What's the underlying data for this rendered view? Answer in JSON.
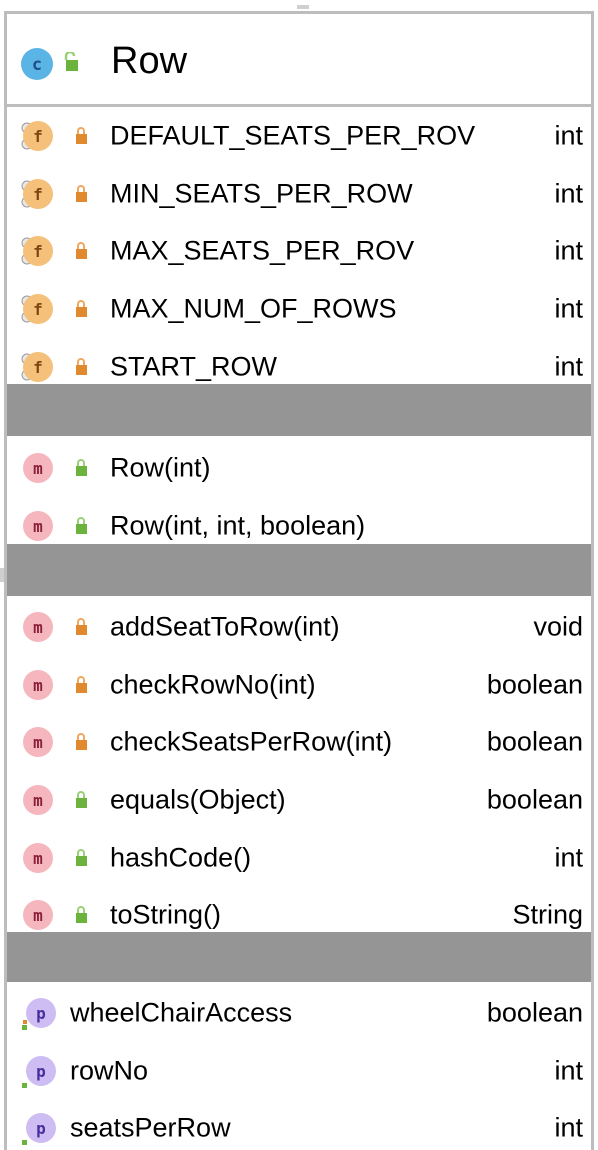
{
  "class": {
    "name": "Row",
    "kind_icon": "class-icon",
    "visibility_icon": "public-icon"
  },
  "fields": [
    {
      "name": "DEFAULT_SEATS_PER_ROV",
      "type": "int",
      "icon": "static-final-field-icon",
      "visibility": "private"
    },
    {
      "name": "MIN_SEATS_PER_ROW",
      "type": "int",
      "icon": "static-final-field-icon",
      "visibility": "private"
    },
    {
      "name": "MAX_SEATS_PER_ROV",
      "type": "int",
      "icon": "static-final-field-icon",
      "visibility": "private"
    },
    {
      "name": "MAX_NUM_OF_ROWS",
      "type": "int",
      "icon": "static-final-field-icon",
      "visibility": "private"
    },
    {
      "name": "START_ROW",
      "type": "int",
      "icon": "static-final-field-icon",
      "visibility": "private"
    }
  ],
  "constructors": [
    {
      "name": "Row(int)",
      "type": "",
      "icon": "method-icon",
      "visibility": "public"
    },
    {
      "name": "Row(int, int, boolean)",
      "type": "",
      "icon": "method-icon",
      "visibility": "public"
    }
  ],
  "methods": [
    {
      "name": "addSeatToRow(int)",
      "type": "void",
      "icon": "method-icon",
      "visibility": "private"
    },
    {
      "name": "checkRowNo(int)",
      "type": "boolean",
      "icon": "method-icon",
      "visibility": "private"
    },
    {
      "name": "checkSeatsPerRow(int)",
      "type": "boolean",
      "icon": "method-icon",
      "visibility": "private"
    },
    {
      "name": "equals(Object)",
      "type": "boolean",
      "icon": "method-icon",
      "visibility": "public"
    },
    {
      "name": "hashCode()",
      "type": "int",
      "icon": "method-icon",
      "visibility": "public"
    },
    {
      "name": "toString()",
      "type": "String",
      "icon": "method-icon",
      "visibility": "public"
    }
  ],
  "properties": [
    {
      "name": "wheelChairAccess",
      "type": "boolean",
      "icon": "property-icon",
      "accessors": "read-write"
    },
    {
      "name": "rowNo",
      "type": "int",
      "icon": "property-icon",
      "accessors": "read"
    },
    {
      "name": "seatsPerRow",
      "type": "int",
      "icon": "property-icon",
      "accessors": "read"
    }
  ],
  "colors": {
    "border": "#bdbdbd",
    "separator": "#959595",
    "class_badge": "#5ab5e6",
    "method_badge": "#f5b7bd",
    "field_badge": "#f5c07a",
    "property_badge": "#cdbdf2",
    "private_lock": "#e0892e",
    "public_lock": "#6cb33e"
  }
}
